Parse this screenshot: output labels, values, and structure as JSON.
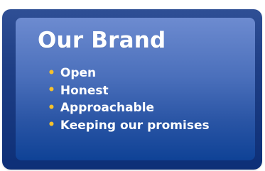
{
  "title": "Our Brand",
  "items": [
    "Open",
    "Honest",
    "Approachable",
    "Keeping our promises"
  ],
  "colors": {
    "bullet": "#f5c12c",
    "text": "#ffffff",
    "frame": "#1f3f86",
    "panel_top": "#6d8bd0",
    "panel_bottom": "#0f4296"
  }
}
